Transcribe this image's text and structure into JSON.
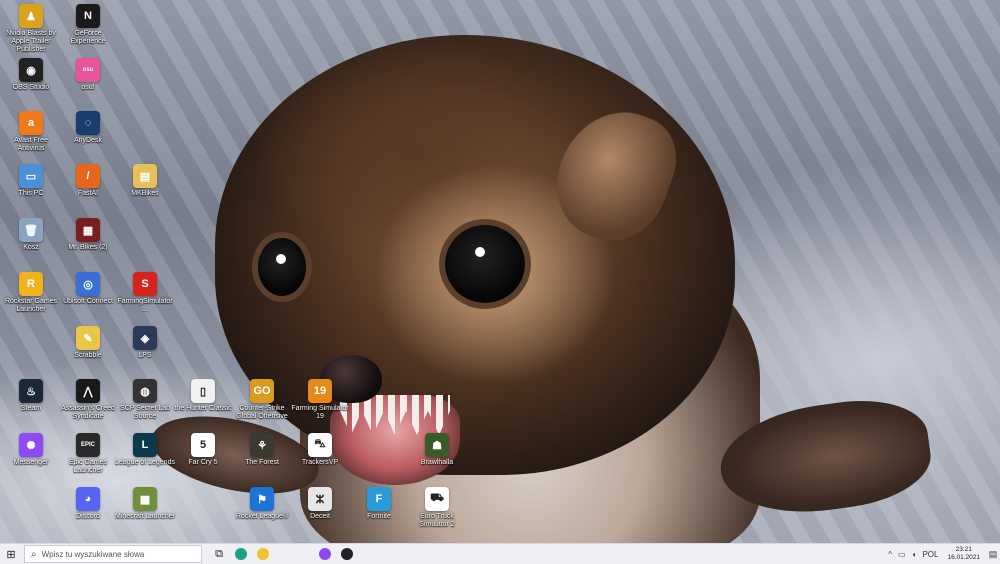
{
  "desktop_icons": [
    {
      "label": "Nvidia Blasts by Apple Trailer Publisher",
      "color": "#d9a320",
      "glyph": "♟"
    },
    {
      "label": "GeForce Experience",
      "color": "#1a1a1a",
      "glyph": "N"
    },
    {
      "label": "OBS Studio",
      "color": "#222222",
      "glyph": "◉"
    },
    {
      "label": "osu!",
      "color": "#e8549a",
      "glyph": "osu"
    },
    {
      "label": "Avast Free Antivirus",
      "color": "#f07a1a",
      "glyph": "a"
    },
    {
      "label": "AnyDesk",
      "color": "#1b3d6e",
      "glyph": "◌"
    },
    {
      "label": "This PC",
      "color": "#4a90d9",
      "glyph": "▭"
    },
    {
      "label": "FastAI",
      "color": "#e8651e",
      "glyph": "/"
    },
    {
      "label": "MKBikes",
      "color": "#e6c15a",
      "glyph": "▤"
    },
    {
      "label": "Kosz",
      "color": "#8aa4c0",
      "glyph": "🗑"
    },
    {
      "label": "Mr. Bikes (2)",
      "color": "#7a1f1f",
      "glyph": "▦"
    },
    {
      "label": "Rockstar Games Launcher",
      "color": "#f0b31d",
      "glyph": "R"
    },
    {
      "label": "Ubisoft Connect",
      "color": "#3b6fd6",
      "glyph": "◎"
    },
    {
      "label": "FarmingSimulator…",
      "color": "#d4241c",
      "glyph": "S"
    },
    {
      "label": "Scrabble",
      "color": "#e8c64a",
      "glyph": "✎"
    },
    {
      "label": "LPS",
      "color": "#2a3b5a",
      "glyph": "◈"
    },
    {
      "label": "Steam",
      "color": "#1b2838",
      "glyph": "♨"
    },
    {
      "label": "Assassin's Creed Syndicate",
      "color": "#1a1a1a",
      "glyph": "⋀"
    },
    {
      "label": "SCP Secret Lab Source",
      "color": "#333333",
      "glyph": "◍"
    },
    {
      "label": "the Hunter Classic",
      "color": "#f1f1f1",
      "glyph": "▯"
    },
    {
      "label": "Counter-Strike Global Offensive",
      "color": "#d99a1e",
      "glyph": "GO"
    },
    {
      "label": "Farming Simulator 19",
      "color": "#e28a1a",
      "glyph": "19"
    },
    {
      "label": "Messenger",
      "color": "#8f48f2",
      "glyph": "✺"
    },
    {
      "label": "Epic Games Launcher",
      "color": "#2a2a2a",
      "glyph": "EPIC"
    },
    {
      "label": "League of Legends",
      "color": "#0b3b4a",
      "glyph": "L"
    },
    {
      "label": "Far Cry 5",
      "color": "#ffffff",
      "glyph": "5"
    },
    {
      "label": "The Forest",
      "color": "#3b3a30",
      "glyph": "⚘"
    },
    {
      "label": "TrackersVP",
      "color": "#ffffff",
      "glyph": "⛍"
    },
    {
      "label": "Brawlhalla",
      "color": "#3b5a2a",
      "glyph": "☗"
    },
    {
      "label": "Discord",
      "color": "#5865f2",
      "glyph": "◕"
    },
    {
      "label": "Minecraft Launcher",
      "color": "#6f8f3a",
      "glyph": "▩"
    },
    {
      "label": "Rocket League®",
      "color": "#1e73d6",
      "glyph": "⚑"
    },
    {
      "label": "Deceit",
      "color": "#e6e6e6",
      "glyph": "ⵣ"
    },
    {
      "label": "Fortnite",
      "color": "#2a9bd9",
      "glyph": "F"
    },
    {
      "label": "Euro Truck Simulator 2",
      "color": "#ffffff",
      "glyph": "⛟"
    }
  ],
  "taskbar": {
    "start_glyph": "⊞",
    "search_placeholder": "Wpisz tu wyszukiwane słowa",
    "search_glyph": "⌕",
    "task_view_glyph": "⧉",
    "pinned": [
      {
        "name": "edge",
        "color": "#1e9e8a"
      },
      {
        "name": "file-explorer",
        "color": "#f1c232"
      },
      {
        "name": "messenger",
        "color": "#8f48f2"
      },
      {
        "name": "obs",
        "color": "#222222"
      }
    ],
    "tray": {
      "chevron": "^",
      "network": "▭",
      "volume": "◖",
      "lang": "POL",
      "time": "23:21",
      "date": "16.01.2021",
      "notif_glyph": "▤"
    }
  }
}
